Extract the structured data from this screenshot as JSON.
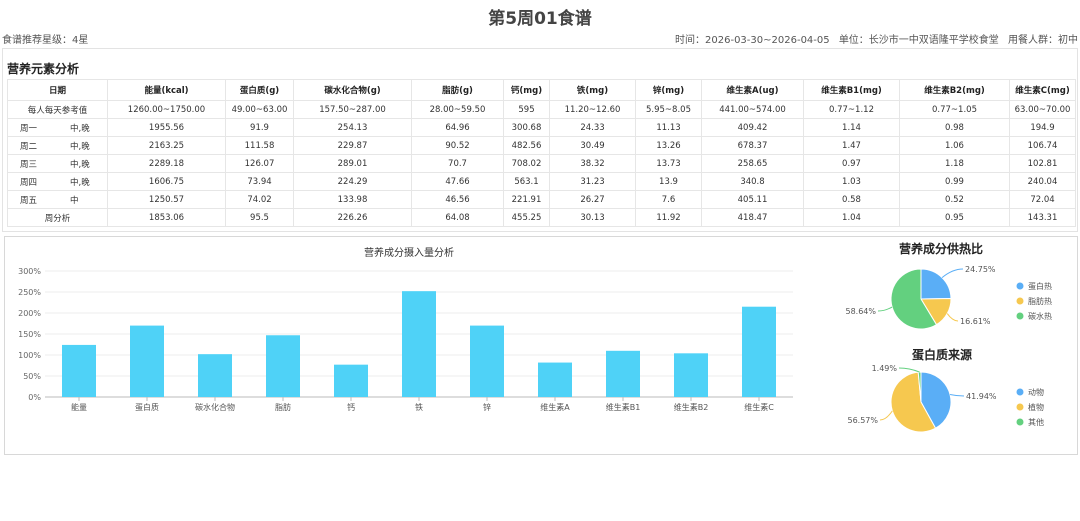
{
  "header": {
    "title": "第5周01食谱",
    "rating": "食谱推荐星级：4星",
    "time": "时间：2026-03-30~2026-04-05",
    "unit": "单位：长沙市一中双语隆平学校食堂",
    "audience": "用餐人群：初中"
  },
  "section_title": "营养元素分析",
  "table": {
    "headers": [
      "日期",
      "能量(kcal)",
      "蛋白质(g)",
      "碳水化合物(g)",
      "脂肪(g)",
      "钙(mg)",
      "铁(mg)",
      "锌(mg)",
      "维生素A(ug)",
      "维生素B1(mg)",
      "维生素B2(mg)",
      "维生素C(mg)"
    ],
    "reference": {
      "label": "每人每天参考值",
      "values": [
        "1260.00~1750.00",
        "49.00~63.00",
        "157.50~287.00",
        "28.00~59.50",
        "595",
        "11.20~12.60",
        "5.95~8.05",
        "441.00~574.00",
        "0.77~1.12",
        "0.77~1.05",
        "63.00~70.00"
      ]
    },
    "rows": [
      {
        "day": "周一",
        "meal": "中,晚",
        "values": [
          "1955.56",
          "91.9",
          "254.13",
          "64.96",
          "300.68",
          "24.33",
          "11.13",
          "409.42",
          "1.14",
          "0.98",
          "194.9"
        ]
      },
      {
        "day": "周二",
        "meal": "中,晚",
        "values": [
          "2163.25",
          "111.58",
          "229.87",
          "90.52",
          "482.56",
          "30.49",
          "13.26",
          "678.37",
          "1.47",
          "1.06",
          "106.74"
        ]
      },
      {
        "day": "周三",
        "meal": "中,晚",
        "values": [
          "2289.18",
          "126.07",
          "289.01",
          "70.7",
          "708.02",
          "38.32",
          "13.73",
          "258.65",
          "0.97",
          "1.18",
          "102.81"
        ]
      },
      {
        "day": "周四",
        "meal": "中,晚",
        "values": [
          "1606.75",
          "73.94",
          "224.29",
          "47.66",
          "563.1",
          "31.23",
          "13.9",
          "340.8",
          "1.03",
          "0.99",
          "240.04"
        ]
      },
      {
        "day": "周五",
        "meal": "中",
        "values": [
          "1250.57",
          "74.02",
          "133.98",
          "46.56",
          "221.91",
          "26.27",
          "7.6",
          "405.11",
          "0.58",
          "0.52",
          "72.04"
        ]
      }
    ],
    "summary": {
      "label": "周分析",
      "values": [
        "1853.06",
        "95.5",
        "226.26",
        "64.08",
        "455.25",
        "30.13",
        "11.92",
        "418.47",
        "1.04",
        "0.95",
        "143.31"
      ]
    }
  },
  "bar_chart": {
    "title": "营养成分摄入量分析",
    "y_ticks": [
      "0%",
      "50%",
      "100%",
      "150%",
      "200%",
      "250%",
      "300%"
    ],
    "color": "#4fd2f7"
  },
  "pie1": {
    "title": "营养成分供热比",
    "labels": [
      "24.75%",
      "16.61%",
      "58.64%"
    ],
    "legend": [
      "蛋白热",
      "脂肪热",
      "碳水热"
    ],
    "colors": [
      "#5aaef6",
      "#f6c84f",
      "#63d07f"
    ]
  },
  "pie2": {
    "title": "蛋白质来源",
    "labels": [
      "41.94%",
      "56.57%",
      "1.49%"
    ],
    "legend": [
      "动物",
      "植物",
      "其他"
    ],
    "colors": [
      "#5aaef6",
      "#f6c84f",
      "#63d07f"
    ]
  },
  "chart_data": [
    {
      "type": "bar",
      "title": "营养成分摄入量分析",
      "categories": [
        "能量",
        "蛋白质",
        "碳水化合物",
        "脂肪",
        "钙",
        "铁",
        "锌",
        "维生素A",
        "维生素B1",
        "维生素B2",
        "维生素C"
      ],
      "values": [
        124,
        170,
        102,
        147,
        77,
        252,
        170,
        82,
        110,
        104,
        215
      ],
      "ylim": [
        0,
        300
      ],
      "y_unit": "%",
      "grid": true
    },
    {
      "type": "pie",
      "title": "营养成分供热比",
      "labels": [
        "蛋白热",
        "脂肪热",
        "碳水热"
      ],
      "values": [
        24.75,
        16.61,
        58.64
      ],
      "legend": "right"
    },
    {
      "type": "pie",
      "title": "蛋白质来源",
      "labels": [
        "动物",
        "植物",
        "其他"
      ],
      "values": [
        41.94,
        56.57,
        1.49
      ],
      "legend": "right"
    }
  ]
}
